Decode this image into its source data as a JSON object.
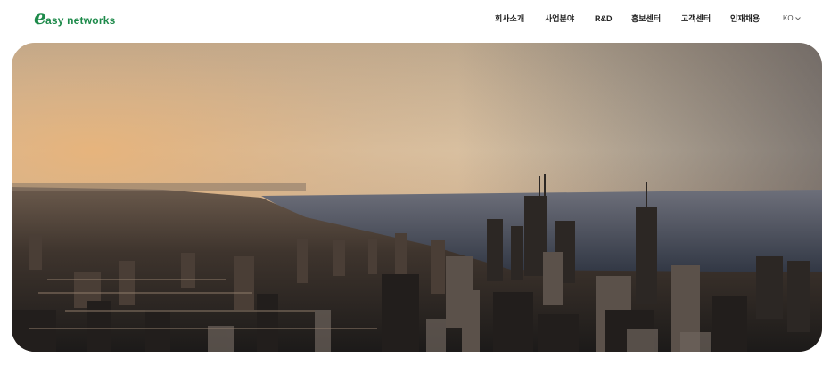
{
  "brand": {
    "logo_initial": "e",
    "logo_rest": "asy networks",
    "color": "#1d8a4a"
  },
  "nav": {
    "items": [
      {
        "label": "회사소개"
      },
      {
        "label": "사업분야"
      },
      {
        "label": "R&D"
      },
      {
        "label": "홍보센터"
      },
      {
        "label": "고객센터"
      },
      {
        "label": "인재채용"
      }
    ],
    "language": "KO",
    "language_icon": "chevron-down-icon"
  },
  "hero": {
    "image": "city-skyline-aerial-sunset"
  }
}
